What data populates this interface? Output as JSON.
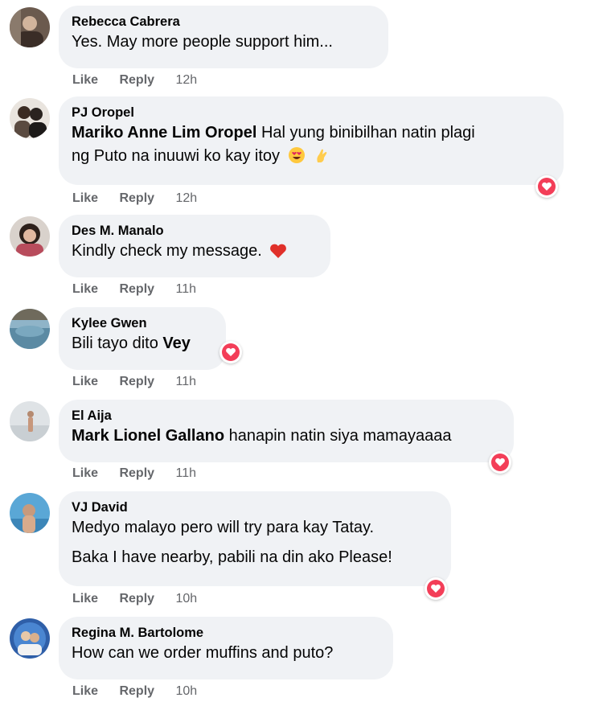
{
  "comments": [
    {
      "author": "Rebecca Cabrera",
      "text": "Yes. May more people support him...",
      "like": "Like",
      "reply": "Reply",
      "time": "12h"
    },
    {
      "author": "PJ Oropel",
      "mention": "Mariko Anne Lim Oropel",
      "text_line1": " Hal yung binibilhan natin plagi",
      "text_line2": "ng Puto na inuuwi ko kay itoy",
      "emojis": [
        "heart-eyes-emoji",
        "pinching-hand-emoji"
      ],
      "like": "Like",
      "reply": "Reply",
      "time": "12h",
      "reaction": "heart-reaction-icon"
    },
    {
      "author": "Des M. Manalo",
      "text": "Kindly check my message.",
      "emojis": [
        "red-heart-emoji"
      ],
      "like": "Like",
      "reply": "Reply",
      "time": "11h"
    },
    {
      "author": "Kylee Gwen",
      "text": "Bili tayo dito ",
      "mention": "Vey",
      "like": "Like",
      "reply": "Reply",
      "time": "11h",
      "reaction": "heart-reaction-icon"
    },
    {
      "author": "El Aija",
      "mention": "Mark Lionel Gallano",
      "text": " hanapin natin siya mamayaaaa",
      "like": "Like",
      "reply": "Reply",
      "time": "11h",
      "reaction": "heart-reaction-icon"
    },
    {
      "author": "VJ David",
      "text_line1": "Medyo malayo pero will try para kay Tatay.",
      "text_line2": "Baka I have nearby, pabili na din ako Please!",
      "like": "Like",
      "reply": "Reply",
      "time": "10h",
      "reaction": "heart-reaction-icon"
    },
    {
      "author": "Regina M. Bartolome",
      "text": "How can we order muffins and puto?",
      "like": "Like",
      "reply": "Reply",
      "time": "10h"
    }
  ],
  "colors": {
    "bubble": "#f0f2f5",
    "meta": "#65676b",
    "heart": "#f33e58"
  }
}
